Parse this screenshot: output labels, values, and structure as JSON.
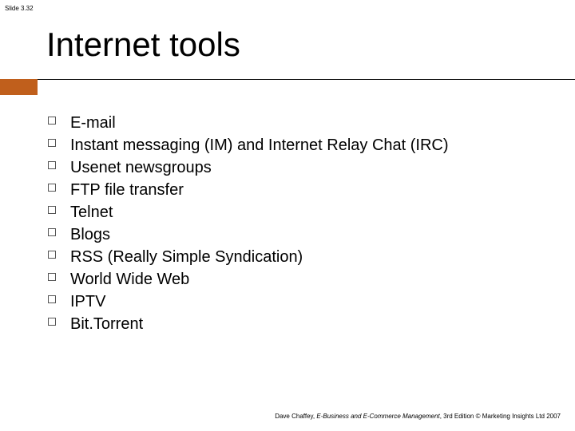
{
  "slide_label": "Slide 3.32",
  "title": "Internet tools",
  "items": [
    "E-mail",
    "Instant messaging (IM) and Internet Relay Chat (IRC)",
    "Usenet newsgroups",
    "FTP file transfer",
    "Telnet",
    "Blogs",
    "RSS (Really Simple Syndication)",
    "World Wide Web",
    "IPTV",
    "Bit.Torrent"
  ],
  "footer": {
    "author": "Dave Chaffey, ",
    "book": "E-Business and E-Commerce Management",
    "rest": ", 3rd Edition © Marketing Insights Ltd 2007"
  }
}
